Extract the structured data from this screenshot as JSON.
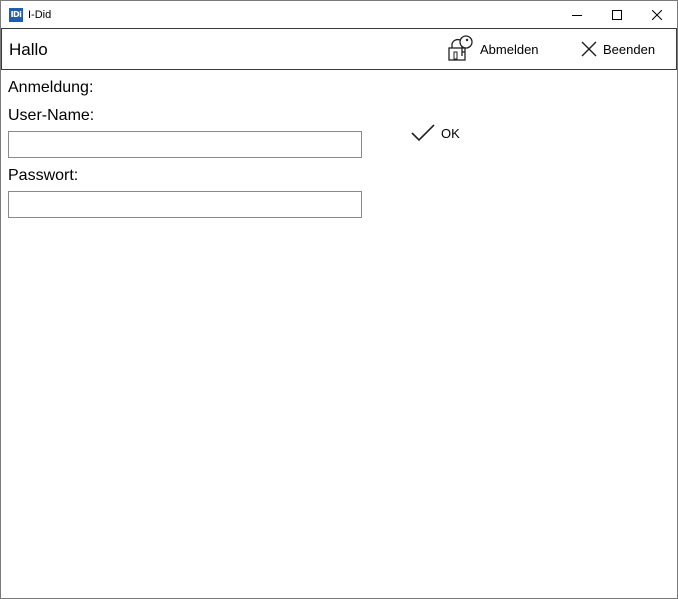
{
  "window": {
    "title": "I-Did",
    "icon_text": "I-Did",
    "controls": [
      "minimize",
      "maximize",
      "close"
    ]
  },
  "toolbar": {
    "greeting": "Hallo",
    "logout_label": "Abmelden",
    "logout_icon": "key-lock-icon",
    "exit_label": "Beenden",
    "exit_icon": "close-icon"
  },
  "login": {
    "heading": "Anmeldung:",
    "username_label": "User-Name:",
    "username_value": "",
    "password_label": "Passwort:",
    "password_value": "",
    "ok_label": "OK",
    "ok_icon": "checkmark-icon"
  }
}
